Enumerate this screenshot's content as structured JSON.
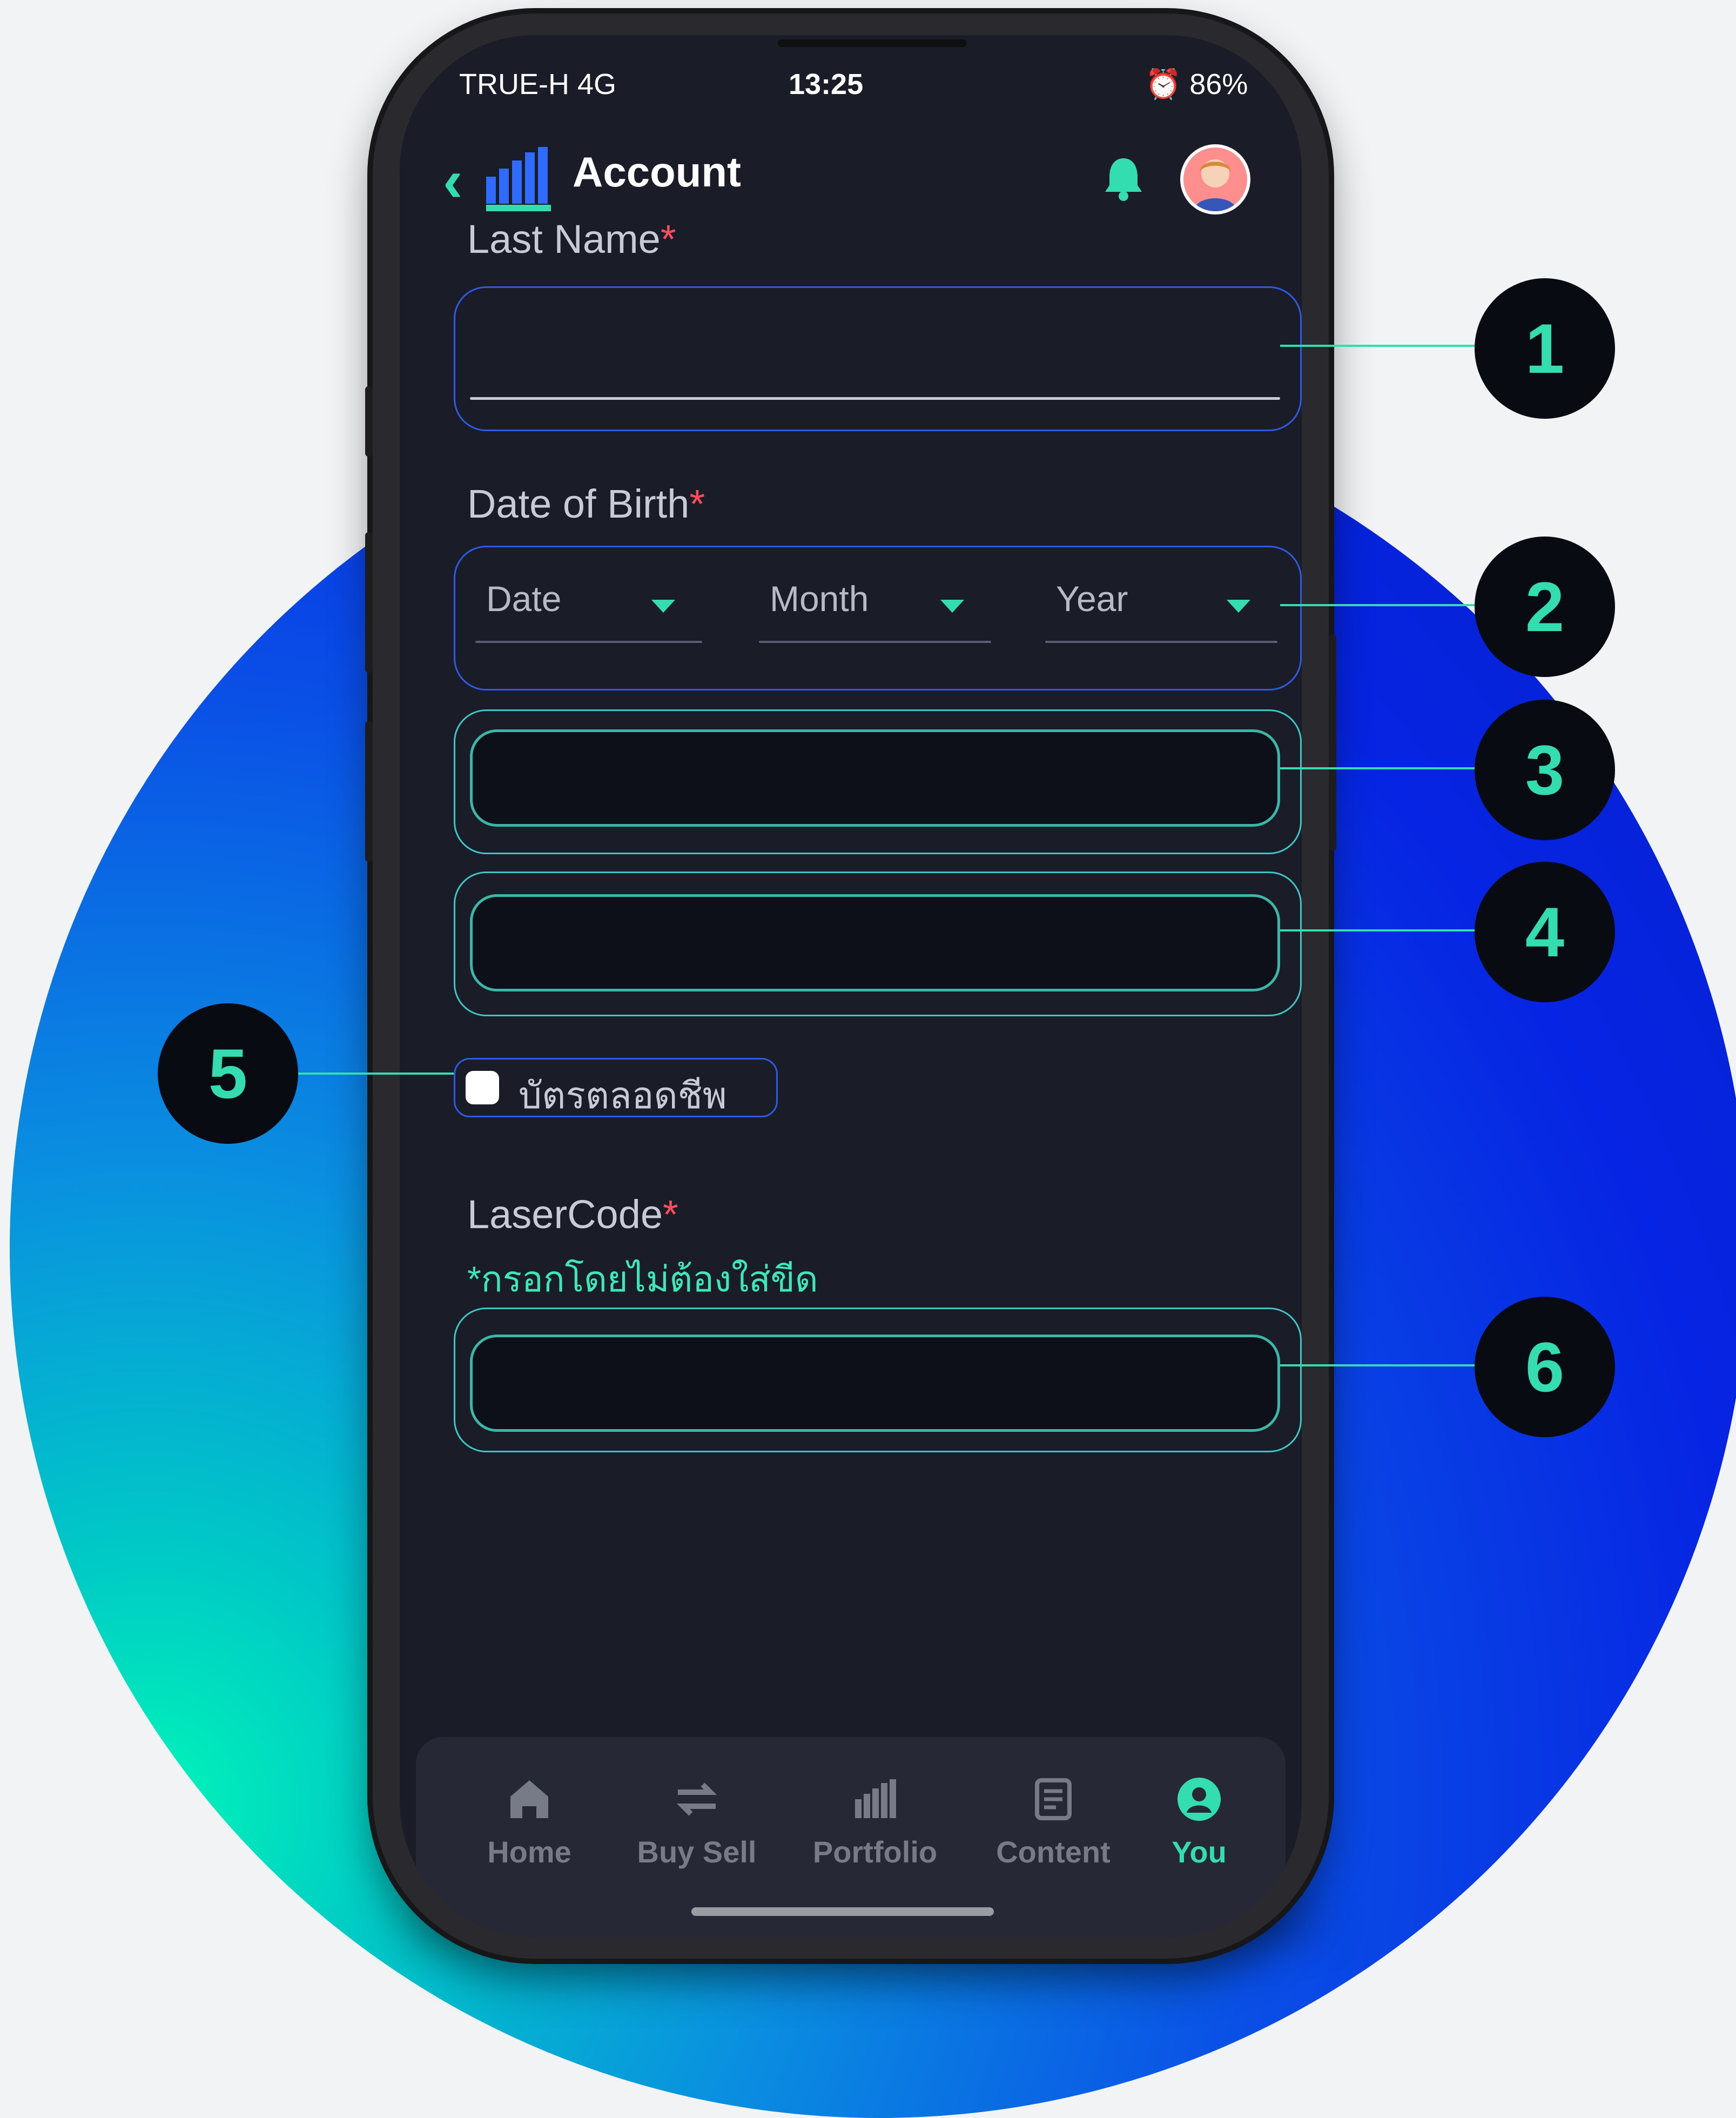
{
  "status_bar": {
    "carrier": "TRUE-H  4G",
    "time": "13:25",
    "battery": "86%"
  },
  "header": {
    "title": "Account"
  },
  "form": {
    "last_name_label": "Last Name",
    "last_name_required": "*",
    "dob_label": "Date of Birth",
    "dob_required": "*",
    "date_placeholder": "Date",
    "month_placeholder": "Month",
    "year_placeholder": "Year",
    "lifetime_card_label": "บัตรตลอดชีพ",
    "laser_code_label": "LaserCode",
    "laser_code_required": "*",
    "laser_code_hint": "*กรอกโดยไม่ต้องใส่ขีด"
  },
  "tabs": [
    {
      "label": "Home",
      "icon": "home-icon"
    },
    {
      "label": "Buy Sell",
      "icon": "swap-icon"
    },
    {
      "label": "Portfolio",
      "icon": "portfolio-icon"
    },
    {
      "label": "Content",
      "icon": "content-icon"
    },
    {
      "label": "You",
      "icon": "user-icon",
      "active": true
    }
  ],
  "callouts": [
    "1",
    "2",
    "3",
    "4",
    "5",
    "6"
  ],
  "colors": {
    "accent": "#33ddb0",
    "background": "#1a1d27",
    "required": "#ff4d5e",
    "highlight_blue": "#2d5ae6"
  }
}
